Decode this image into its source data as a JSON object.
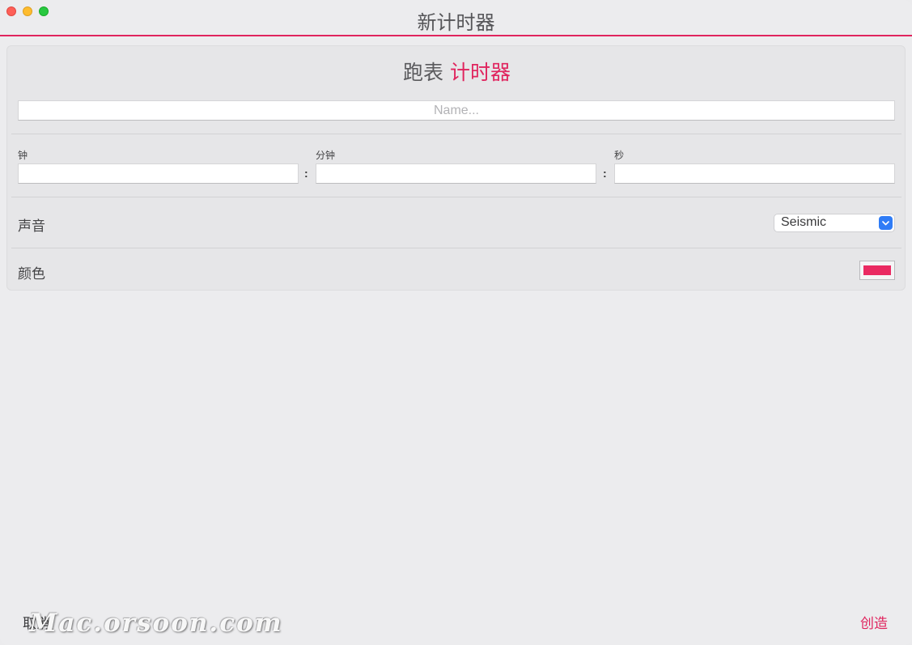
{
  "window": {
    "title": "新计时器"
  },
  "form": {
    "heading_prefix": "跑表",
    "heading_accent": "计时器",
    "name_placeholder": "Name...",
    "hours_label": "钟",
    "minutes_label": "分钟",
    "seconds_label": "秒",
    "time_separator": ":",
    "sound_label": "声音",
    "sound_value": "Seismic",
    "color_label": "颜色",
    "color_value": "#ea2a62"
  },
  "footer": {
    "cancel_label": "取消",
    "create_label": "创造"
  },
  "watermark": "Mac.orsoon.com",
  "colors": {
    "accent": "#e0245e",
    "select_arrow": "#2f7cf6"
  },
  "icons": {
    "close": "close-window-icon",
    "minimize": "minimize-window-icon",
    "maximize": "maximize-window-icon",
    "dropdown": "chevron-down-icon"
  }
}
